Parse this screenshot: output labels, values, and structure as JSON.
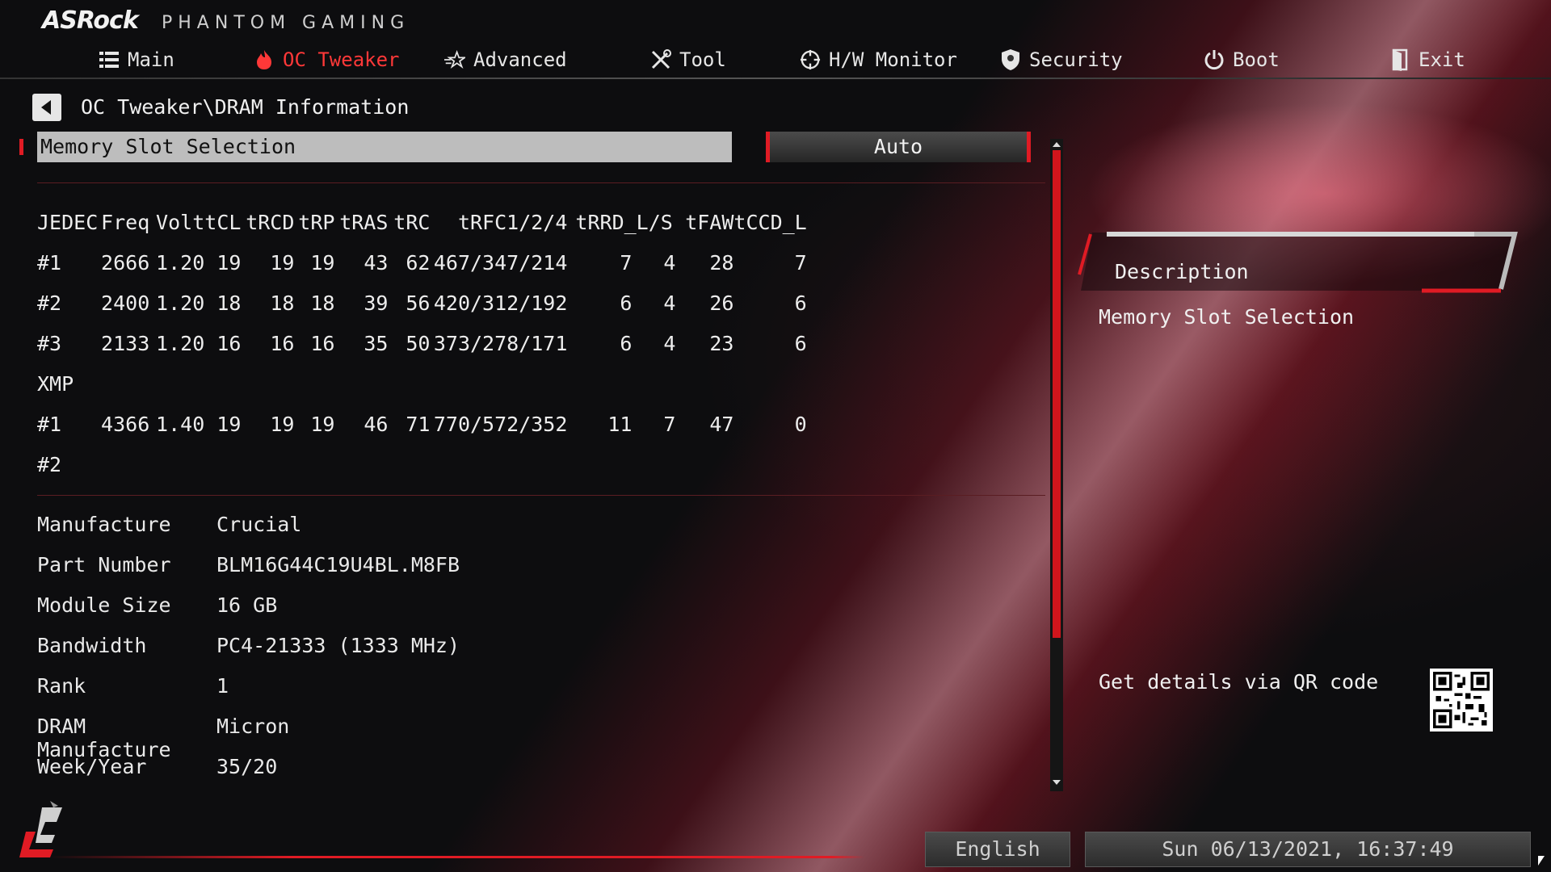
{
  "header": {
    "brand": "ASRock",
    "brand_sub": "PHANTOM GAMING",
    "tabs": [
      {
        "label": "Main",
        "icon": "list-icon"
      },
      {
        "label": "OC Tweaker",
        "icon": "flame-icon"
      },
      {
        "label": "Advanced",
        "icon": "star-icon"
      },
      {
        "label": "Tool",
        "icon": "tools-icon"
      },
      {
        "label": "H/W Monitor",
        "icon": "crosshair-icon"
      },
      {
        "label": "Security",
        "icon": "shield-icon"
      },
      {
        "label": "Boot",
        "icon": "power-icon"
      },
      {
        "label": "Exit",
        "icon": "exit-door-icon"
      }
    ],
    "active_tab": "OC Tweaker"
  },
  "breadcrumb": "OC Tweaker\\DRAM Information",
  "selection": {
    "label": "Memory Slot Selection",
    "value": "Auto"
  },
  "timings": {
    "columns": [
      "JEDEC",
      "Freq",
      "Volt",
      "tCL",
      "tRCD",
      "tRP",
      "tRAS",
      "tRC",
      "tRFC1/2/4",
      "tRRD_L/S",
      "",
      "tFAW",
      "tCCD_L"
    ],
    "jedec_rows": [
      [
        "#1",
        "2666",
        "1.20",
        "19",
        "19",
        "19",
        "43",
        "62",
        "467/347/214",
        "7",
        "4",
        "28",
        "7"
      ],
      [
        "#2",
        "2400",
        "1.20",
        "18",
        "18",
        "18",
        "39",
        "56",
        "420/312/192",
        "6",
        "4",
        "26",
        "6"
      ],
      [
        "#3",
        "2133",
        "1.20",
        "16",
        "16",
        "16",
        "35",
        "50",
        "373/278/171",
        "6",
        "4",
        "23",
        "6"
      ]
    ],
    "xmp_label": "XMP",
    "xmp_rows": [
      [
        "#1",
        "4366",
        "1.40",
        "19",
        "19",
        "19",
        "46",
        "71",
        "770/572/352",
        "11",
        "7",
        "47",
        "0"
      ],
      [
        "#2",
        "",
        "",
        "",
        "",
        "",
        "",
        "",
        "",
        "",
        "",
        "",
        ""
      ]
    ]
  },
  "info": [
    {
      "key": "Manufacture",
      "value": "Crucial"
    },
    {
      "key": "Part Number",
      "value": "BLM16G44C19U4BL.M8FB"
    },
    {
      "key": "Module Size",
      "value": "16 GB"
    },
    {
      "key": "Bandwidth",
      "value": "PC4-21333 (1333 MHz)"
    },
    {
      "key": "Rank",
      "value": "1"
    },
    {
      "key": "DRAM Manufacture",
      "value": "Micron"
    },
    {
      "key": "Week/Year",
      "value": "35/20"
    }
  ],
  "description": {
    "title": "Description",
    "text": "Memory Slot Selection",
    "qr_label": "Get details via QR code"
  },
  "footer": {
    "language": "English",
    "datetime": "Sun 06/13/2021, 16:37:49"
  },
  "colors": {
    "accent": "#e01b24",
    "active_tab": "#ff3838",
    "selected_row_bg": "#bdbdbd",
    "text": "#e9e9e9"
  }
}
